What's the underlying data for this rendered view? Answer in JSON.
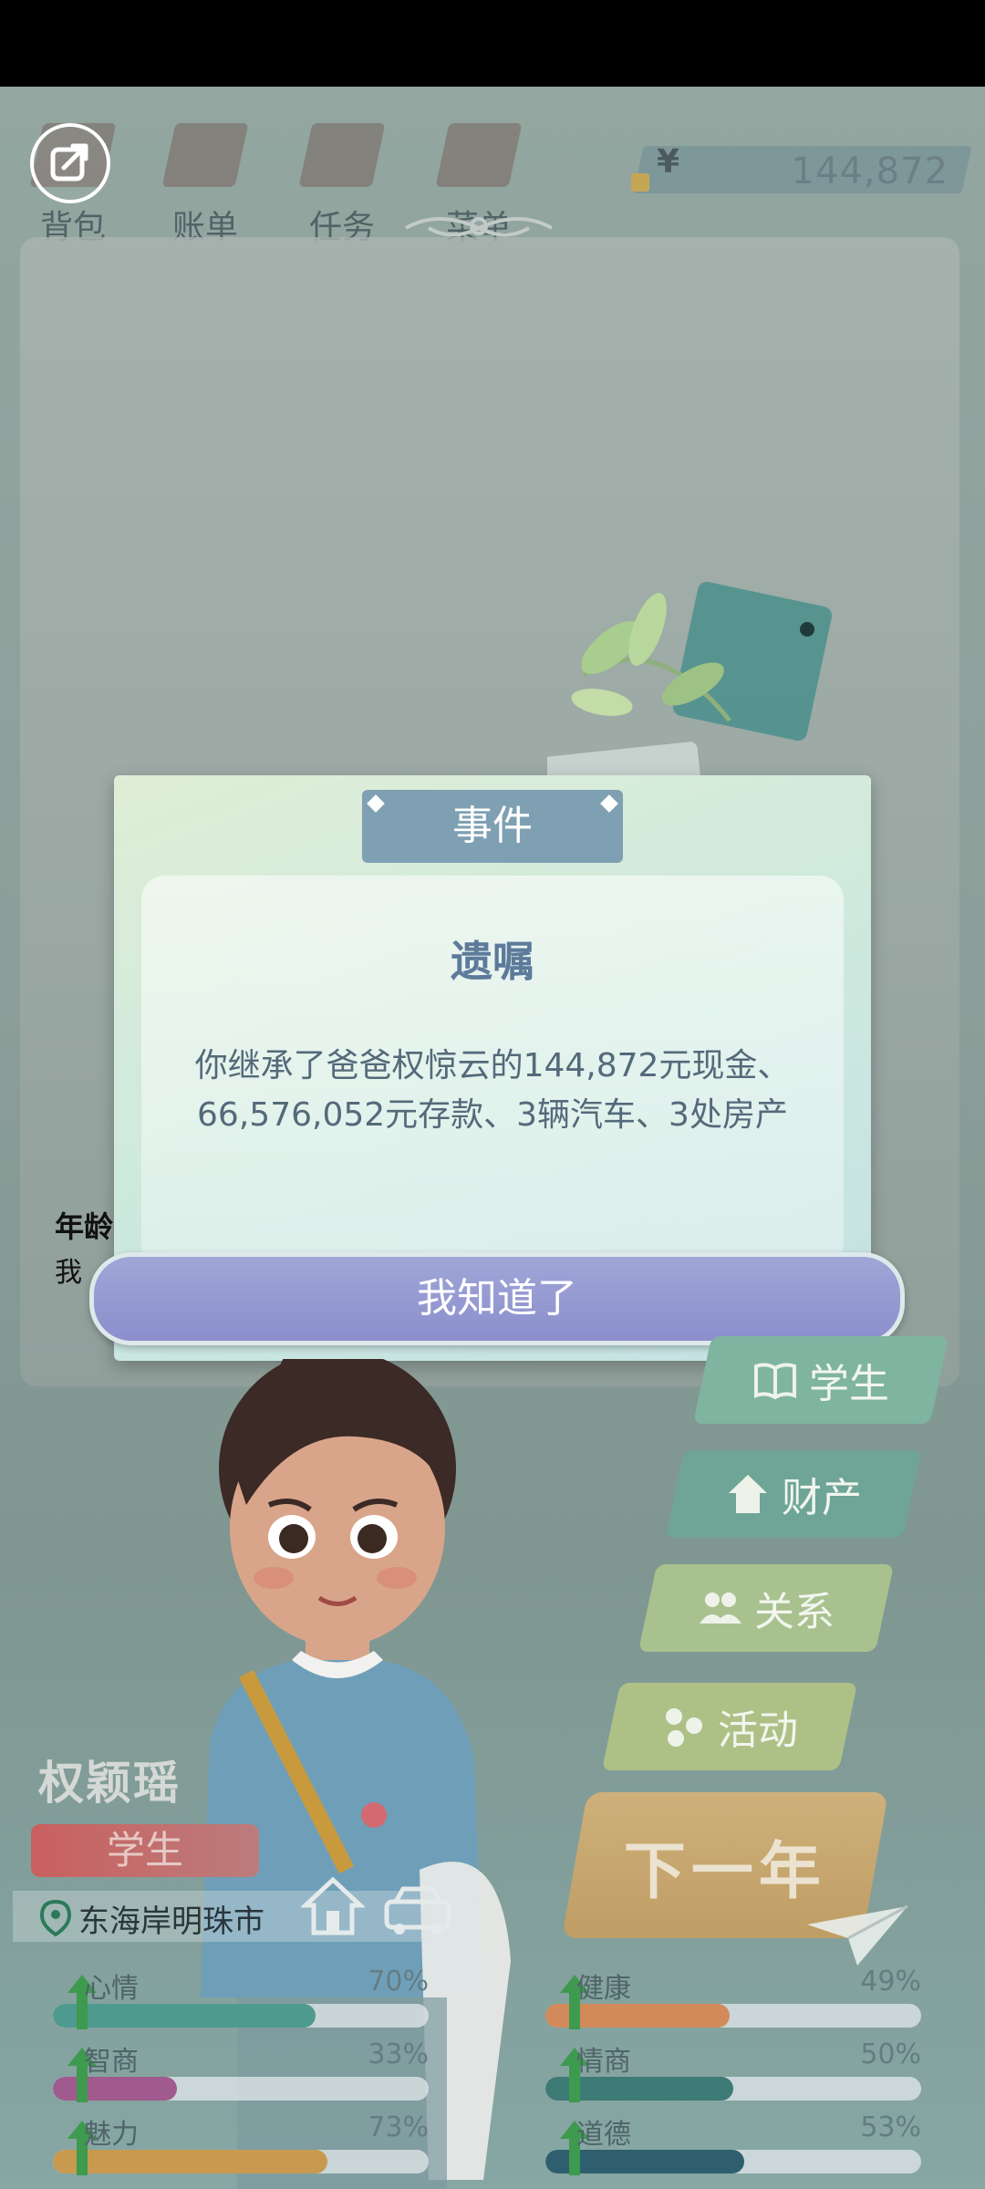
{
  "top_nav": {
    "items": [
      {
        "label": "背包",
        "icon": "backpack-icon"
      },
      {
        "label": "账单",
        "icon": "bill-icon"
      },
      {
        "label": "任务",
        "icon": "task-icon"
      },
      {
        "label": "菜单",
        "icon": "menu-icon"
      }
    ],
    "money_symbol": "¥",
    "money": "144,872"
  },
  "background_text": {
    "age_label": "年龄",
    "line2": "我"
  },
  "dialog": {
    "tab": "事件",
    "title": "遗嘱",
    "body": "你继承了爸爸权惊云的144,872元现金、66,576,052元存款、3辆汽车、3处房产",
    "button": "我知道了"
  },
  "right_menu": [
    {
      "label": "学生",
      "icon": "book-icon",
      "color": "#7fb4a0"
    },
    {
      "label": "财产",
      "icon": "house-icon",
      "color": "#6ea597"
    },
    {
      "label": "关系",
      "icon": "people-icon",
      "color": "#a9c18f"
    },
    {
      "label": "活动",
      "icon": "activity-icon",
      "color": "#adc187"
    }
  ],
  "next_year": "下一年",
  "player": {
    "name": "权颖瑶",
    "role": "学生",
    "location": "东海岸明珠市"
  },
  "stats": [
    {
      "label": "心情",
      "percent": "70%",
      "value": 0.7,
      "color": "#4f9a8f"
    },
    {
      "label": "健康",
      "percent": "49%",
      "value": 0.49,
      "color": "#d28a5a"
    },
    {
      "label": "智商",
      "percent": "33%",
      "value": 0.33,
      "color": "#a05a8e"
    },
    {
      "label": "情商",
      "percent": "50%",
      "value": 0.5,
      "color": "#3e7a76"
    },
    {
      "label": "魅力",
      "percent": "73%",
      "value": 0.73,
      "color": "#c89a50"
    },
    {
      "label": "道德",
      "percent": "53%",
      "value": 0.53,
      "color": "#2f5f6e"
    }
  ]
}
